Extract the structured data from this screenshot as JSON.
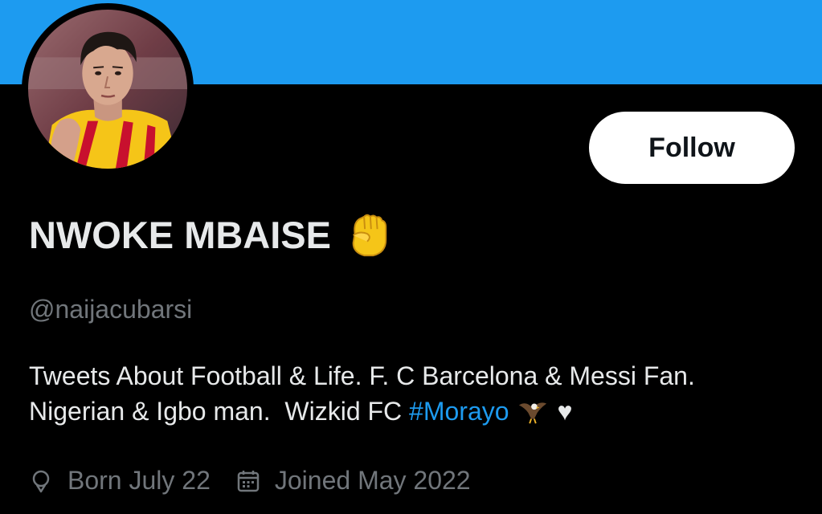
{
  "profile": {
    "display_name": "NWOKE MBAISE",
    "name_emoji": "raised-fist-emoji",
    "handle": "@naijacubarsi",
    "follow_label": "Follow",
    "bio": {
      "line1": "Tweets About Football & Life. F. C Barcelona & Messi Fan.",
      "line2_text": "Nigerian & Igbo man.  Wizkid FC ",
      "hashtag": "#Morayo",
      "eagle_emoji": "eagle-emoji",
      "heart": "♥"
    },
    "born": "Born July 22",
    "joined": "Joined May 2022"
  },
  "colors": {
    "banner": "#1d9bf0",
    "background": "#000000",
    "text_primary": "#e7e9ea",
    "text_secondary": "#71767b",
    "link": "#1d9bf0",
    "follow_bg": "#ffffff",
    "follow_text": "#0f1419"
  },
  "icons": {
    "location": "location-pin-icon",
    "calendar": "calendar-icon"
  }
}
